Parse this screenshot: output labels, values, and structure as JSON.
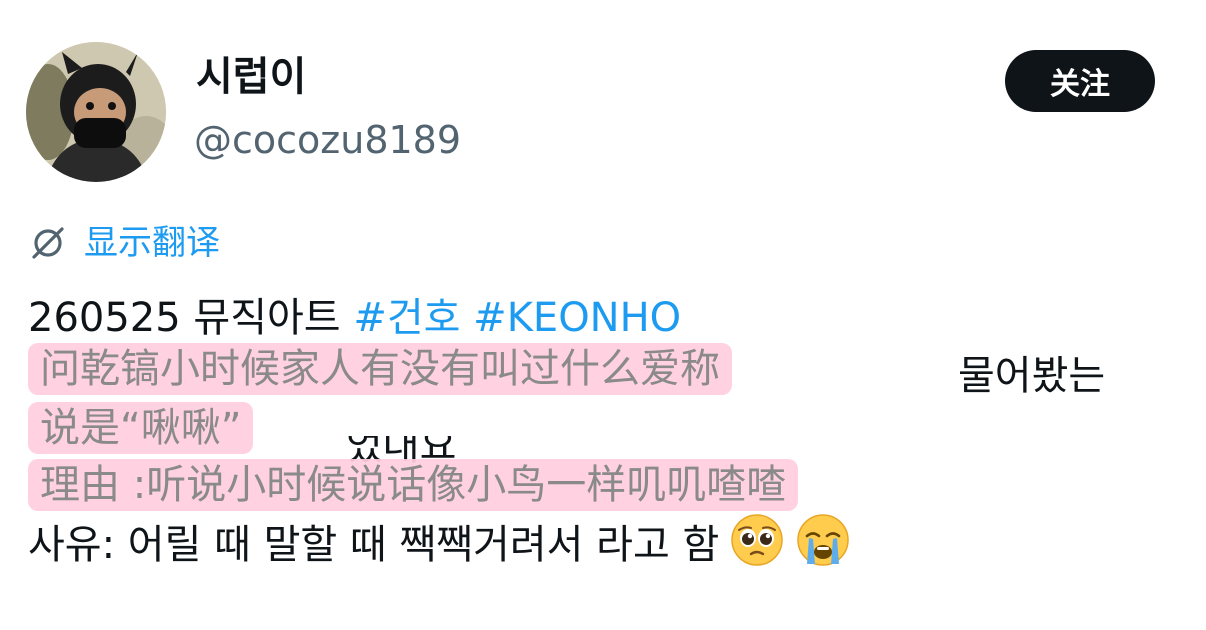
{
  "header": {
    "display_name": "시럽이",
    "handle": "@cocozu8189",
    "follow_label": "关注"
  },
  "translate": {
    "icon": "translate-slash-icon",
    "label": "显示翻译"
  },
  "tweet": {
    "line1_text": "260525 뮤직아트 ",
    "hashtags": [
      "#건호",
      "#KEONHO"
    ],
    "line2_visible_tail": "물어봤는",
    "line3_visible_fragment": "었대요",
    "line5_text": "사유: 어릴 때 말할 때 짹짹거려서 라고 함",
    "emojis": [
      "pleading-face-icon",
      "loudly-crying-face-icon"
    ]
  },
  "overlay": {
    "line1": "问乾镐小时候家人有没有叫过什么爱称",
    "line2": "说是“啾啾”",
    "line3": "理由 :听说小时候说话像小鸟一样叽叽喳喳"
  },
  "colors": {
    "link": "#1d9bf0",
    "button_bg": "#0f1419",
    "secondary_text": "#536471",
    "overlay_bg": "#ffcdde"
  }
}
